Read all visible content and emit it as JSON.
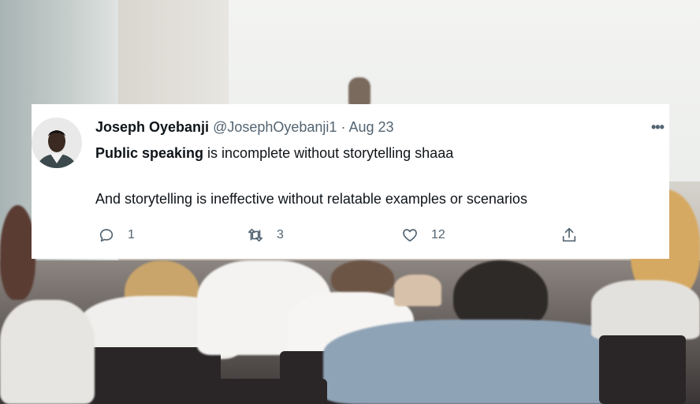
{
  "tweet": {
    "display_name": "Joseph Oyebanji",
    "handle": "@JosephOyebanji1",
    "separator": "·",
    "date": "Aug 23",
    "more_label": "•••",
    "text_bold": "Public speaking",
    "text_line1_rest": " is incomplete without storytelling shaaa",
    "text_line2": "And storytelling is ineffective without relatable examples or scenarios",
    "actions": {
      "reply_count": "1",
      "retweet_count": "3",
      "like_count": "12"
    }
  },
  "icons": [
    "reply-icon",
    "retweet-icon",
    "like-icon",
    "share-icon",
    "more-icon"
  ],
  "colors": {
    "card_bg": "#ffffff",
    "text_primary": "#0f1419",
    "text_secondary": "#536471"
  }
}
